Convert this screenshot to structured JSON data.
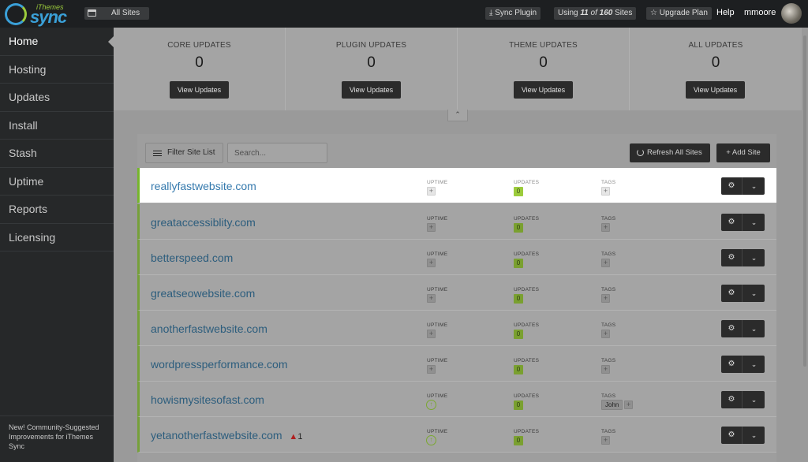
{
  "header": {
    "logo_small": "iThemes",
    "logo_main": "sync",
    "all_sites": "All Sites",
    "sync_plugin": "Sync Plugin",
    "usage_prefix": "Using",
    "usage_used": "11",
    "usage_of": "of",
    "usage_total": "160",
    "usage_suffix": "Sites",
    "upgrade": "Upgrade Plan",
    "help": "Help",
    "username": "mmoore"
  },
  "sidebar": {
    "items": [
      {
        "label": "Home"
      },
      {
        "label": "Hosting"
      },
      {
        "label": "Updates"
      },
      {
        "label": "Install"
      },
      {
        "label": "Stash"
      },
      {
        "label": "Uptime"
      },
      {
        "label": "Reports"
      },
      {
        "label": "Licensing"
      }
    ],
    "footer": "New! Community-Suggested Improvements for iThemes Sync"
  },
  "stats": [
    {
      "title": "CORE UPDATES",
      "value": "0",
      "button": "View Updates"
    },
    {
      "title": "PLUGIN UPDATES",
      "value": "0",
      "button": "View Updates"
    },
    {
      "title": "THEME UPDATES",
      "value": "0",
      "button": "View Updates"
    },
    {
      "title": "ALL UPDATES",
      "value": "0",
      "button": "View Updates"
    }
  ],
  "toolbar": {
    "filter_label": "Filter Site List",
    "search_placeholder": "Search...",
    "refresh_label": "Refresh All Sites",
    "add_label": "+ Add Site"
  },
  "columns": {
    "uptime": "UPTIME",
    "updates": "UPDATES",
    "tags": "TAGS"
  },
  "sites": [
    {
      "name": "reallyfastwebsite.com",
      "updates": "0",
      "uptime": "+",
      "tag": "",
      "warning": ""
    },
    {
      "name": "greataccessiblity.com",
      "updates": "0",
      "uptime": "+",
      "tag": "",
      "warning": ""
    },
    {
      "name": "betterspeed.com",
      "updates": "0",
      "uptime": "+",
      "tag": "",
      "warning": ""
    },
    {
      "name": "greatseowebsite.com",
      "updates": "0",
      "uptime": "+",
      "tag": "",
      "warning": ""
    },
    {
      "name": "anotherfastwebsite.com",
      "updates": "0",
      "uptime": "+",
      "tag": "",
      "warning": ""
    },
    {
      "name": "wordpressperformance.com",
      "updates": "0",
      "uptime": "+",
      "tag": "",
      "warning": ""
    },
    {
      "name": "howismysitesofast.com",
      "updates": "0",
      "uptime": "↑",
      "tag": "John",
      "warning": ""
    },
    {
      "name": "yetanotherfastwebsite.com",
      "updates": "0",
      "uptime": "↑",
      "tag": "",
      "warning": "1"
    }
  ],
  "icons": {
    "gear": "⚙",
    "caret": "⌄",
    "collapse": "⌃",
    "warn": "▲",
    "plus": "+"
  },
  "colors": {
    "accent_blue": "#3479ad",
    "accent_green": "#9ccc3c",
    "dark": "#2b2b2b"
  }
}
